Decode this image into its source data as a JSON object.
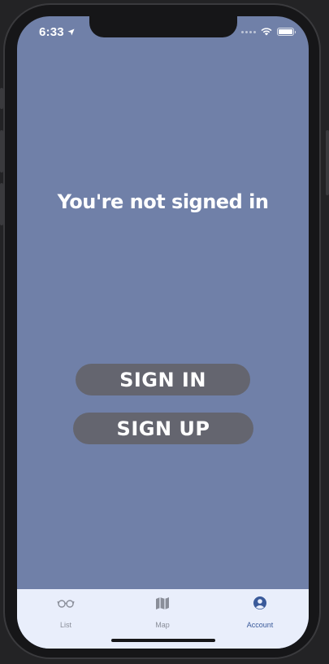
{
  "status_bar": {
    "time": "6:33",
    "location_icon": "location-arrow-icon",
    "signal_icon": "signal-dots-icon",
    "wifi_icon": "wifi-icon",
    "battery_icon": "battery-icon",
    "battery_level": 1.0
  },
  "colors": {
    "screen_background": "#7080a8",
    "button_background": "#64656f",
    "tab_bar_background": "#e9eefb",
    "tab_active": "#3a5a9a",
    "tab_inactive": "#8a8e99"
  },
  "main": {
    "headline": "You're not signed in",
    "sign_in_label": "SIGN IN",
    "sign_up_label": "SIGN UP"
  },
  "tab_bar": {
    "items": [
      {
        "label": "List",
        "icon": "glasses-icon",
        "active": false
      },
      {
        "label": "Map",
        "icon": "map-icon",
        "active": false
      },
      {
        "label": "Account",
        "icon": "account-icon",
        "active": true
      }
    ]
  }
}
